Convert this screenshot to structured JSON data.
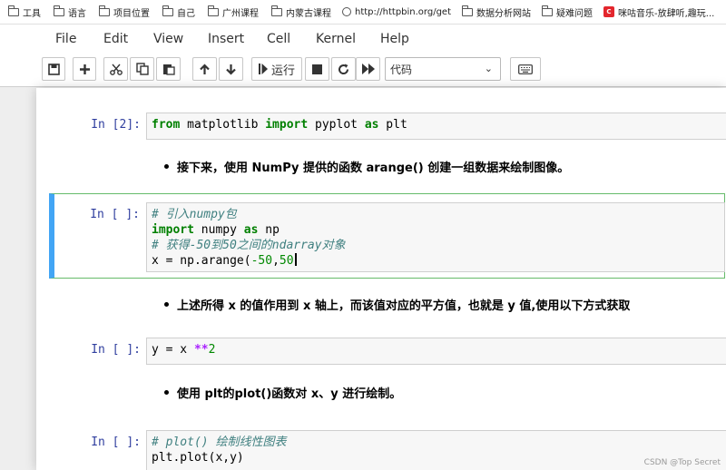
{
  "bookmarks": [
    {
      "label": "工具",
      "icon": "folder-icon"
    },
    {
      "label": "语言",
      "icon": "folder-icon"
    },
    {
      "label": "项目位置",
      "icon": "folder-icon"
    },
    {
      "label": "自己",
      "icon": "folder-icon"
    },
    {
      "label": "广州课程",
      "icon": "folder-icon"
    },
    {
      "label": "内蒙古课程",
      "icon": "folder-icon"
    },
    {
      "label": "http://httpbin.org/get",
      "icon": "globe-icon"
    },
    {
      "label": "数据分析网站",
      "icon": "folder-icon"
    },
    {
      "label": "疑难问题",
      "icon": "folder-icon"
    },
    {
      "label": "咪咕音乐-放肆听,趣玩...",
      "icon": "csdn-icon"
    }
  ],
  "menu": [
    "File",
    "Edit",
    "View",
    "Insert",
    "Cell",
    "Kernel",
    "Help"
  ],
  "toolbar": {
    "run_label": "运行",
    "cell_type": "代码"
  },
  "cells": {
    "c1": {
      "prompt": "In [2]:"
    },
    "m1": {
      "text": "接下来，使用 NumPy 提供的函数 arange() 创建一组数据来绘制图像。"
    },
    "c2": {
      "prompt": "In [ ]:"
    },
    "m2": {
      "text": "上述所得 x 的值作用到 x 轴上，而该值对应的平方值，也就是 y 值,使用以下方式获取"
    },
    "c3": {
      "prompt": "In [ ]:"
    },
    "m3": {
      "text": "使用 plt的plot()函数对 x、y 进行绘制。"
    },
    "c4": {
      "prompt": "In [ ]:"
    }
  },
  "code": {
    "c1": {
      "kw1": "from",
      "mod": " matplotlib ",
      "kw2": "import",
      "rest": " pyplot ",
      "kw3": "as",
      "alias": " plt"
    },
    "c2": {
      "comment1": "# 引入numpy包",
      "kw_import": "import",
      "mid": " numpy ",
      "kw_as": "as",
      "alias": " np",
      "comment2": "# 获得-50到50之间的ndarray对象",
      "assign": "x = np.arange(",
      "arg1": "-50",
      "sep": ",",
      "arg2": "50"
    },
    "c3": {
      "lhs": "y = x ",
      "op": "**",
      "num": "2"
    },
    "c4": {
      "comment": "# plot() 绘制线性图表",
      "line2": "plt.plot(x,y)"
    }
  },
  "watermark": "CSDN @Top Secret"
}
